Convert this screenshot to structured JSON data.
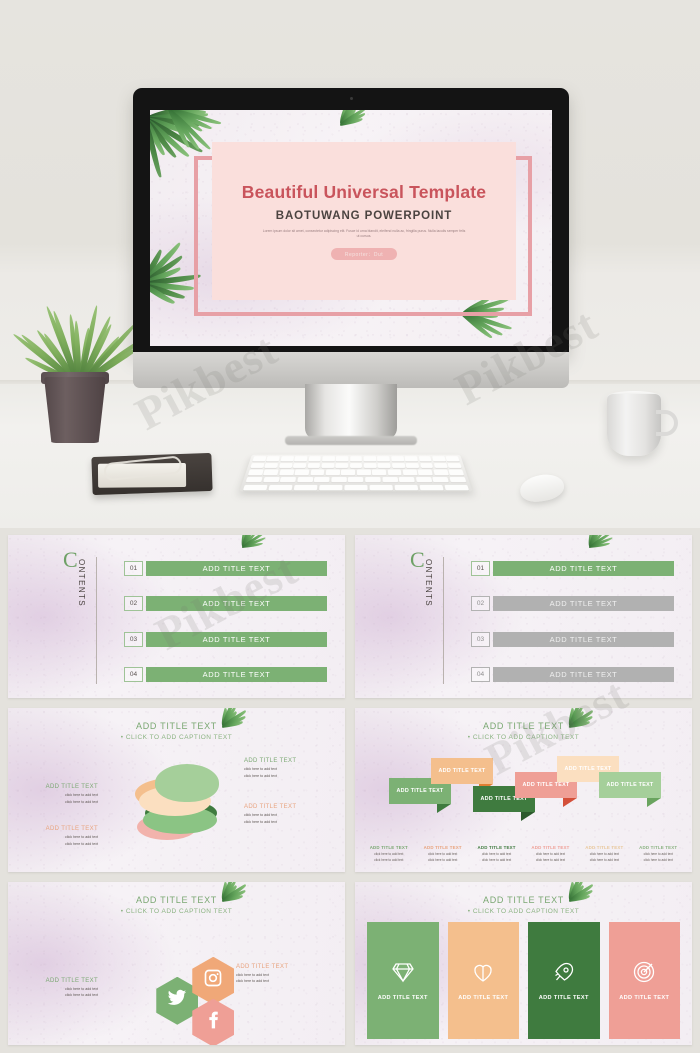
{
  "hero": {
    "title_slide": {
      "main_title": "Beautiful Universal Template",
      "subtitle": "BAOTUWANG POWERPOINT",
      "lorem": "Lorem ipsum dolor sit amet, consectetur adipiscing elit. Fusce id urna blandit, eleifend nulla ac, fringilla purus. Nulla iaculis semper felis ut cursus.",
      "reporter_badge": "Reporter：Dut"
    },
    "objects": {
      "monitor": "desktop-monitor",
      "plant": "potted-plant",
      "notebook": "notebook-and-glasses",
      "keyboard": "keyboard",
      "mouse": "mouse",
      "mug": "coffee-mug"
    }
  },
  "watermarks": [
    "Pikbest",
    "Pikbest",
    "Pikbest",
    "Pikbest"
  ],
  "colors": {
    "green": "#7cb174",
    "green_dark": "#3f7b3f",
    "green_light": "#a5cf9a",
    "gray": "#b1b1b1",
    "orange": "#f4bf8d",
    "peach": "#fbdfc0",
    "pink": "#f1a89f",
    "rose": "#ef9f96",
    "title_red": "#c9545c",
    "card_pink": "#fadfdc",
    "frame_pink": "#e7a0a6",
    "slide_title": "#7ba873",
    "wall": "#e4e2dd"
  },
  "slides": [
    {
      "id": "contents-green",
      "type": "contents",
      "letter": "C",
      "word": "ONTENTS",
      "items": [
        {
          "num": "01",
          "label": "ADD TITLE TEXT",
          "state": "active"
        },
        {
          "num": "02",
          "label": "ADD TITLE TEXT",
          "state": "active"
        },
        {
          "num": "03",
          "label": "ADD TITLE TEXT",
          "state": "active"
        },
        {
          "num": "04",
          "label": "ADD TITLE TEXT",
          "state": "active"
        }
      ]
    },
    {
      "id": "contents-mixed",
      "type": "contents",
      "letter": "C",
      "word": "ONTENTS",
      "items": [
        {
          "num": "01",
          "label": "ADD TITLE TEXT",
          "state": "active"
        },
        {
          "num": "02",
          "label": "ADD TITLE TEXT",
          "state": "inactive"
        },
        {
          "num": "03",
          "label": "ADD TITLE TEXT",
          "state": "inactive"
        },
        {
          "num": "04",
          "label": "ADD TITLE TEXT",
          "state": "inactive"
        }
      ]
    },
    {
      "id": "macaron",
      "type": "macaron-diagram",
      "title": "ADD TITLE TEXT",
      "caption": "• CLICK TO ADD CAPTION TEXT",
      "blocks": [
        {
          "title": "ADD TITLE TEXT",
          "color": "#7ba873",
          "line1": "click here to add text",
          "line2": "click here to add text",
          "side": "left"
        },
        {
          "title": "ADD TITLE TEXT",
          "color": "#e8a37e",
          "line1": "click here to add text",
          "line2": "click here to add text",
          "side": "left"
        },
        {
          "title": "ADD TITLE TEXT",
          "color": "#7ba873",
          "line1": "click here to add text",
          "line2": "click here to add text",
          "side": "right"
        },
        {
          "title": "ADD TITLE TEXT",
          "color": "#e8a37e",
          "line1": "click here to add text",
          "line2": "click here to add text",
          "side": "right"
        }
      ]
    },
    {
      "id": "zigzag",
      "type": "zigzag-blocks",
      "title": "ADD TITLE TEXT",
      "caption": "• CLICK TO ADD CAPTION TEXT",
      "blocks": [
        {
          "label": "ADD TITLE TEXT",
          "color": "#7cb174",
          "tail": "#3f7b3f"
        },
        {
          "label": "ADD TITLE TEXT",
          "color": "#f4bf8d",
          "tail": "#e07f33"
        },
        {
          "label": "ADD TITLE TEXT",
          "color": "#3f7b3f",
          "tail": "#2c5a2c"
        },
        {
          "label": "ADD TITLE TEXT",
          "color": "#ef9f96",
          "tail": "#d4503a"
        },
        {
          "label": "ADD TITLE TEXT",
          "color": "#fbdfc0",
          "tail": "#e8a050"
        },
        {
          "label": "ADD TITLE TEXT",
          "color": "#a5cf9a",
          "tail": "#6aa45f"
        }
      ],
      "captions": [
        {
          "title": "ADD TITLE TEXT",
          "color": "#7ba873",
          "line1": "click here to add text",
          "line2": "click here to add text"
        },
        {
          "title": "ADD TITLE TEXT",
          "color": "#e8a37e",
          "line1": "click here to add text",
          "line2": "click here to add text"
        },
        {
          "title": "ADD TITLE TEXT",
          "color": "#3f7b3f",
          "line1": "click here to add text",
          "line2": "click here to add text"
        },
        {
          "title": "ADD TITLE TEXT",
          "color": "#ef9f96",
          "line1": "click here to add text",
          "line2": "click here to add text"
        },
        {
          "title": "ADD TITLE TEXT",
          "color": "#e8c79a",
          "line1": "click here to add text",
          "line2": "click here to add text"
        },
        {
          "title": "ADD TITLE TEXT",
          "color": "#8bb382",
          "line1": "click here to add text",
          "line2": "click here to add text"
        }
      ]
    },
    {
      "id": "social-hex",
      "type": "hexagon-social",
      "title": "ADD TITLE TEXT",
      "caption": "• CLICK TO ADD CAPTION TEXT",
      "hexes": [
        {
          "icon": "twitter-icon",
          "color": "#7cb174"
        },
        {
          "icon": "instagram-icon",
          "color": "#f0a878"
        },
        {
          "icon": "facebook-icon",
          "color": "#ef9f96"
        }
      ],
      "blocks": [
        {
          "title": "ADD TITLE TEXT",
          "color": "#7ba873",
          "line1": "click here to add text",
          "line2": "click here to add text"
        },
        {
          "title": "ADD TITLE TEXT",
          "color": "#e8a37e",
          "line1": "click here to add text",
          "line2": "click here to add text"
        }
      ]
    },
    {
      "id": "icon-cards",
      "type": "icon-cards",
      "title": "ADD TITLE TEXT",
      "caption": "• CLICK TO ADD CAPTION TEXT",
      "cards": [
        {
          "icon": "diamond-icon",
          "label": "ADD TITLE TEXT",
          "color": "#7cb174"
        },
        {
          "icon": "heart-icon",
          "label": "ADD TITLE TEXT",
          "color": "#f4bf8d"
        },
        {
          "icon": "rocket-icon",
          "label": "ADD TITLE TEXT",
          "color": "#3f7b3f"
        },
        {
          "icon": "target-icon",
          "label": "ADD TITLE TEXT",
          "color": "#ef9f96"
        }
      ]
    }
  ]
}
